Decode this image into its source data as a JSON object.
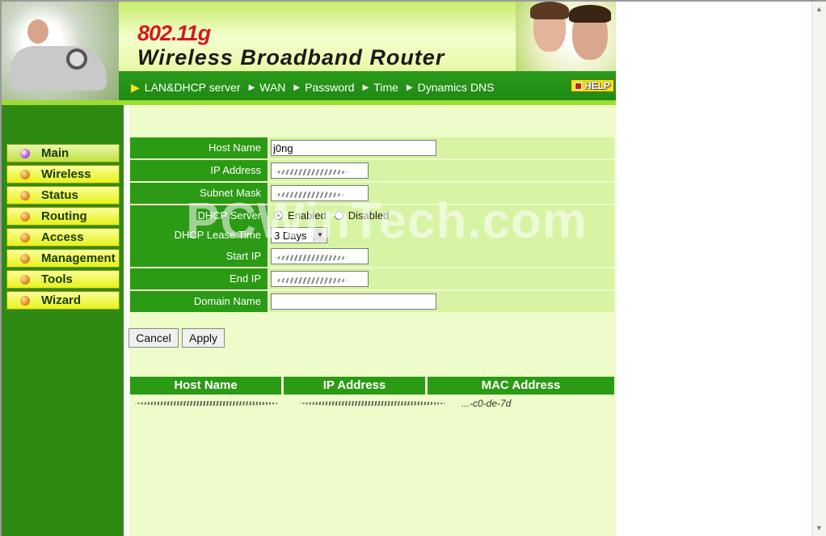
{
  "header": {
    "model": "802.11g",
    "title": "Wireless Broadband Router",
    "help_label": "HELP"
  },
  "nav": [
    {
      "label": "LAN&DHCP server"
    },
    {
      "label": "WAN"
    },
    {
      "label": "Password"
    },
    {
      "label": "Time"
    },
    {
      "label": "Dynamics DNS"
    }
  ],
  "sidebar": {
    "items": [
      {
        "label": "Main",
        "active": true
      },
      {
        "label": "Wireless"
      },
      {
        "label": "Status"
      },
      {
        "label": "Routing"
      },
      {
        "label": "Access"
      },
      {
        "label": "Management"
      },
      {
        "label": "Tools"
      },
      {
        "label": "Wizard"
      }
    ]
  },
  "form": {
    "host_name_label": "Host Name",
    "host_name_value": "j0ng",
    "ip_address_label": "IP Address",
    "subnet_mask_label": "Subnet Mask",
    "dhcp_server_label": "DHCP Server",
    "dhcp_enabled_label": "Enabled",
    "dhcp_disabled_label": "Disabled",
    "dhcp_server_selected": "Enabled",
    "lease_time_label": "DHCP Lease Time",
    "lease_time_value": "3 Days",
    "start_ip_label": "Start IP",
    "end_ip_label": "End IP",
    "domain_name_label": "Domain Name",
    "domain_name_value": ""
  },
  "buttons": {
    "cancel": "Cancel",
    "apply": "Apply"
  },
  "client_table": {
    "columns": [
      "Host Name",
      "IP Address",
      "MAC Address"
    ],
    "mac_partial": "...-c0-de-7d"
  },
  "watermark": "PCWinTech.com",
  "colors": {
    "header_green": "#2b9a14",
    "sidebar_green": "#2f8a14",
    "main_bg": "#edfcc8",
    "row_bg": "#d6f4a4",
    "menu_yellow": "#e6f21a",
    "brand_red": "#d81818"
  }
}
